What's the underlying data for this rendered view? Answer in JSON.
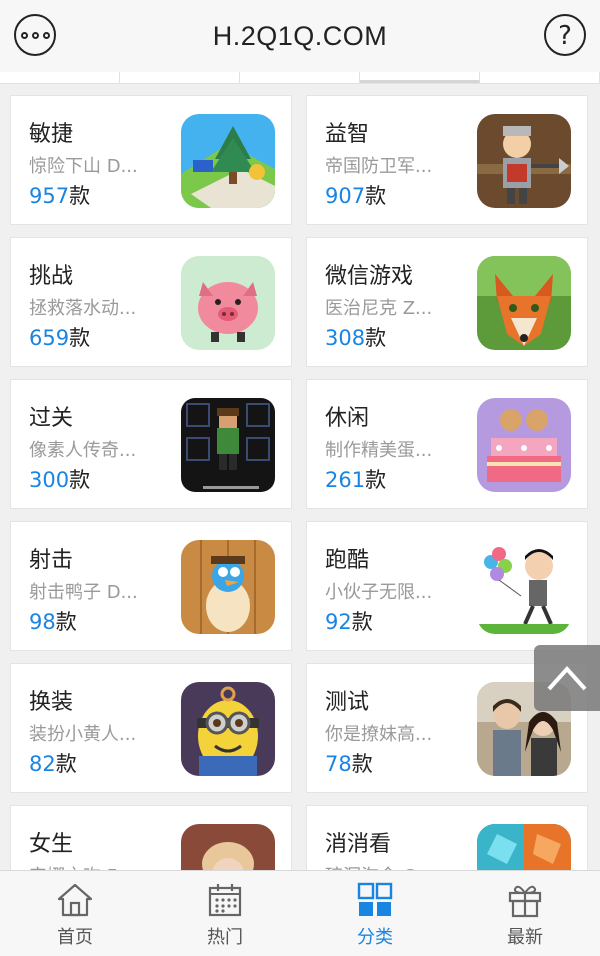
{
  "header": {
    "title": "H.2Q1Q.COM",
    "menu_icon": "more-dots-icon",
    "help_icon": "help-circle-icon"
  },
  "categories": [
    {
      "name": "敏捷",
      "desc": "惊险下山 D...",
      "count": "957",
      "unit": "款"
    },
    {
      "name": "益智",
      "desc": "帝国防卫军...",
      "count": "907",
      "unit": "款"
    },
    {
      "name": "挑战",
      "desc": "拯救落水动...",
      "count": "659",
      "unit": "款"
    },
    {
      "name": "微信游戏",
      "desc": "医治尼克 Z...",
      "count": "308",
      "unit": "款"
    },
    {
      "name": "过关",
      "desc": "像素人传奇...",
      "count": "300",
      "unit": "款"
    },
    {
      "name": "休闲",
      "desc": "制作精美蛋...",
      "count": "261",
      "unit": "款"
    },
    {
      "name": "射击",
      "desc": "射击鸭子 D...",
      "count": "98",
      "unit": "款"
    },
    {
      "name": "跑酷",
      "desc": "小伙子无限...",
      "count": "92",
      "unit": "款"
    },
    {
      "name": "换装",
      "desc": "装扮小黄人...",
      "count": "82",
      "unit": "款"
    },
    {
      "name": "测试",
      "desc": "你是撩妹高...",
      "count": "78",
      "unit": "款"
    },
    {
      "name": "女生",
      "desc": "安娜之吻 Fr...",
      "count": "",
      "unit": ""
    },
    {
      "name": "消消看",
      "desc": "琼洞淘金 G...",
      "count": "",
      "unit": ""
    }
  ],
  "bottom_nav": [
    {
      "label": "首页",
      "icon": "home-icon"
    },
    {
      "label": "热门",
      "icon": "calendar-icon"
    },
    {
      "label": "分类",
      "icon": "grid-icon",
      "active": true
    },
    {
      "label": "最新",
      "icon": "gift-icon"
    }
  ],
  "colors": {
    "accent": "#1a84e2",
    "text": "#222222",
    "muted": "#9a9a9a"
  }
}
